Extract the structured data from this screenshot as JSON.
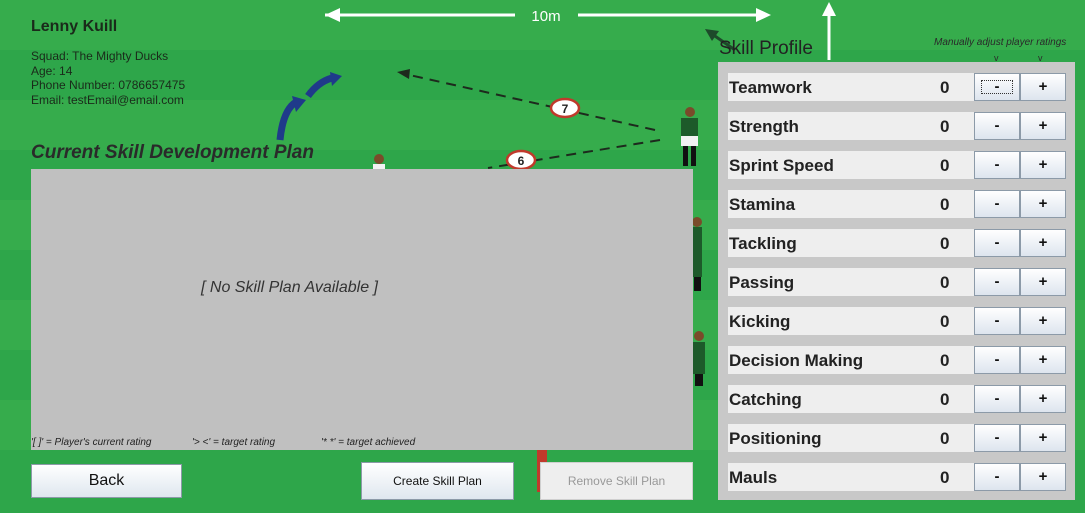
{
  "player": {
    "name": "Lenny Kuill",
    "squad": "Squad: The Mighty Ducks",
    "age": "Age: 14",
    "phone": "Phone Number: 0786657475",
    "email": "Email: testEmail@email.com"
  },
  "field_graphic": {
    "distance_label": "10m",
    "numbers": [
      "7",
      "6"
    ]
  },
  "plan": {
    "title": "Current Skill Development Plan",
    "empty_text": "[ No Skill Plan Available ]",
    "legend": [
      "'[ ]' = Player's current rating",
      "'> <' = target rating",
      "'* *' = target achieved"
    ]
  },
  "buttons": {
    "back": "Back",
    "create": "Create Skill Plan",
    "remove": "Remove Skill Plan"
  },
  "skill_profile": {
    "title": "Skill Profile",
    "manual_label": "Manually adjust player ratings",
    "marker": "v",
    "minus_label": "-",
    "plus_label": "+",
    "skills": [
      {
        "name": "Teamwork",
        "value": "0"
      },
      {
        "name": "Strength",
        "value": "0"
      },
      {
        "name": "Sprint Speed",
        "value": "0"
      },
      {
        "name": "Stamina",
        "value": "0"
      },
      {
        "name": "Tackling",
        "value": "0"
      },
      {
        "name": "Passing",
        "value": "0"
      },
      {
        "name": "Kicking",
        "value": "0"
      },
      {
        "name": "Decision Making",
        "value": "0"
      },
      {
        "name": "Catching",
        "value": "0"
      },
      {
        "name": "Positioning",
        "value": "0"
      },
      {
        "name": "Mauls",
        "value": "0"
      }
    ]
  },
  "colors": {
    "field": "#2ea64a",
    "stripe": "#36ac4c",
    "panel": "#c0c0c0"
  }
}
